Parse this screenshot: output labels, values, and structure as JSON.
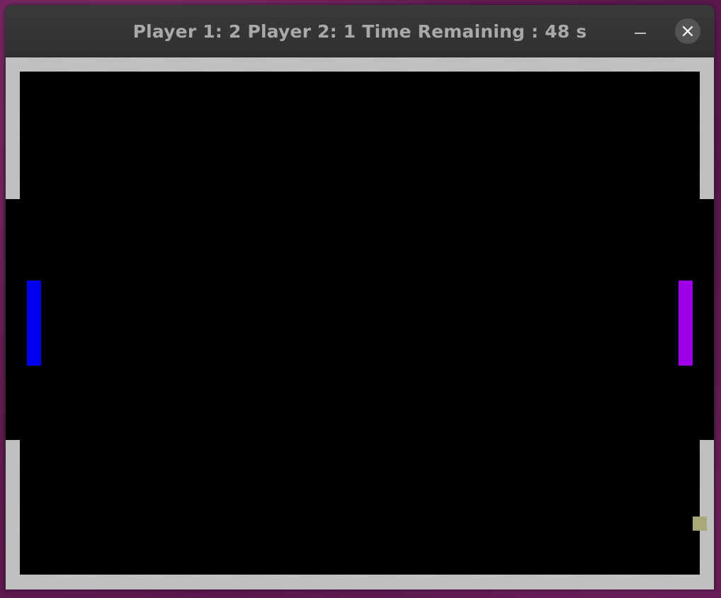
{
  "window": {
    "title": "Player 1: 2 Player 2: 1 Time Remaining : 48 s"
  },
  "controls": {
    "minimize_icon": "minimize-icon",
    "close_icon": "close-icon"
  },
  "score": {
    "player1": 2,
    "player2": 1,
    "time_remaining_s": 48
  },
  "colors": {
    "field": "#000000",
    "wall": "#c3c3c3",
    "paddle_left": "#0000ee",
    "paddle_right": "#a000e8",
    "ball": "#a8a878"
  }
}
